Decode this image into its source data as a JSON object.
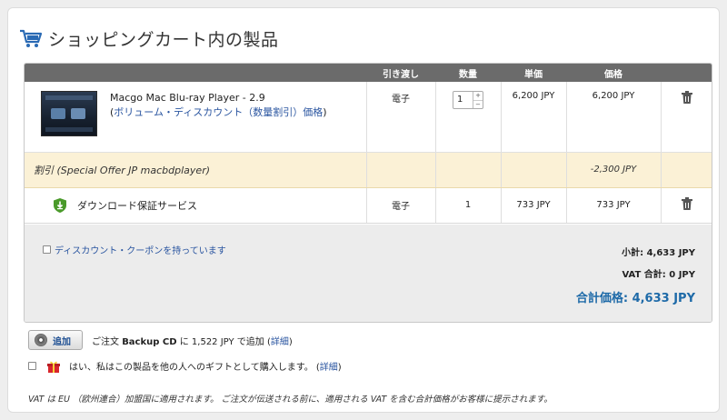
{
  "header": {
    "title": "ショッピングカート内の製品",
    "icon": "cart-icon"
  },
  "table": {
    "columns": [
      "",
      "引き渡し",
      "数量",
      "単価",
      "価格",
      ""
    ],
    "product": {
      "name": "Macgo Mac Blu-ray Player - 2.9",
      "paren_open": "(",
      "discount_link": "ボリューム・ディスカウント（数量割引）価格",
      "paren_close": ")",
      "delivery": "電子",
      "quantity": "1",
      "unit_price": "6,200 JPY",
      "price": "6,200 JPY"
    },
    "discount": {
      "label": "割引 (Special Offer JP macbdplayer)",
      "amount": "-2,300 JPY"
    },
    "service": {
      "name": "ダウンロード保証サービス",
      "delivery": "電子",
      "quantity": "1",
      "unit_price": "733 JPY",
      "price": "733 JPY"
    }
  },
  "summary": {
    "coupon_label": "ディスカウント・クーポンを持っています",
    "subtotal": "小計: 4,633 JPY",
    "vat": "VAT 合計: 0 JPY",
    "total": "合計価格: 4,633 JPY"
  },
  "addon": {
    "button_label": "追加",
    "text_prefix": "ご注文",
    "product": "Backup CD",
    "text_suffix": "に 1,522 JPY で追加",
    "details_open": "(",
    "details_link": "詳細",
    "details_close": ")"
  },
  "gift": {
    "text": "はい、私はこの製品を他の人へのギフトとして購入します。",
    "details_open": "(",
    "details_link": "詳細",
    "details_close": ")"
  },
  "note": "VAT は EU （欧州連合）加盟国に適用されます。 ご注文が伝送される前に、適用される VAT を含む合計価格がお客様に提示されます。",
  "colors": {
    "header_bar": "#6b6b6b",
    "link": "#2a55a0",
    "total": "#1e6aa8",
    "discount_bg": "#fbf1d6",
    "summary_bg": "#ececec"
  }
}
